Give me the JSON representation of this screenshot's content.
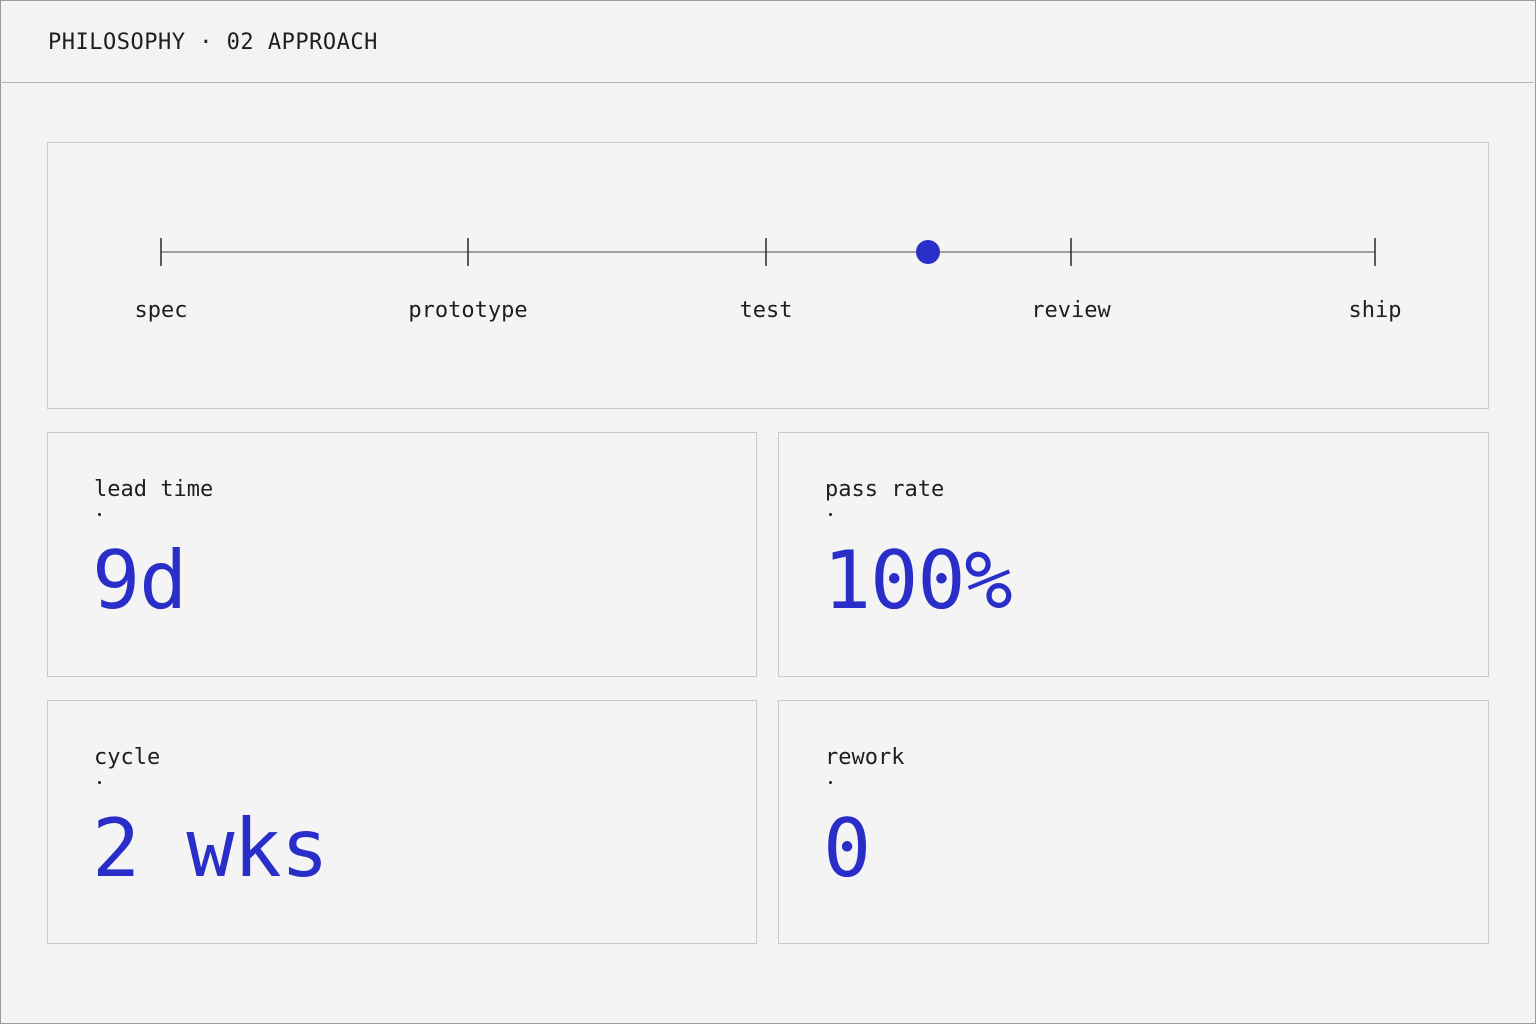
{
  "header": {
    "title": "PHILOSOPHY · 02 APPROACH"
  },
  "timeline": {
    "stages": [
      {
        "label": "spec"
      },
      {
        "label": "prototype"
      },
      {
        "label": "test"
      },
      {
        "label": "review"
      },
      {
        "label": "ship"
      }
    ],
    "progress_marker": {
      "between": [
        "test",
        "review"
      ],
      "fraction_between": 0.53
    }
  },
  "metrics": [
    {
      "label": "lead time",
      "value": "9d"
    },
    {
      "label": "pass rate",
      "value": "100%"
    },
    {
      "label": "cycle",
      "value": "2 wks"
    },
    {
      "label": "rework",
      "value": "0"
    }
  ],
  "colors": {
    "accent": "#2a2ec9",
    "background": "#f3f3f3",
    "border": "#c9c9c9"
  }
}
